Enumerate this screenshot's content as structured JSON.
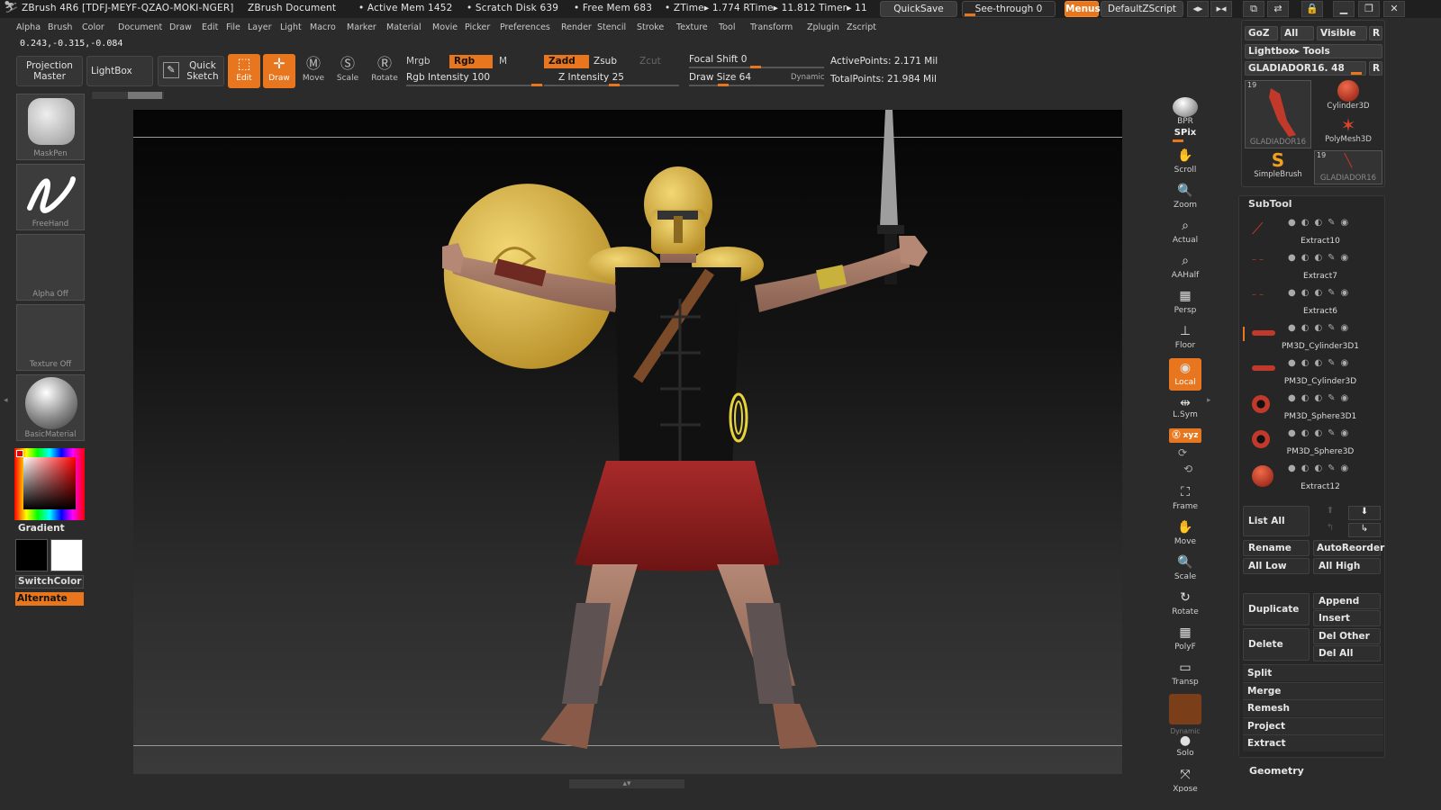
{
  "titlebar": {
    "app": "ZBrush 4R6 [TDFJ-MEYF-QZAO-MOKI-NGER]",
    "document": "ZBrush Document",
    "active_mem": "• Active Mem 1452",
    "scratch_disk": "• Scratch Disk 639",
    "free_mem": "• Free Mem 683",
    "ztime": "• ZTime▸ 1.774 RTime▸ 11.812 Timer▸ 11",
    "quicksave": "QuickSave",
    "see_through": "See-through  0",
    "menus": "Menus",
    "default_zscript": "DefaultZScript"
  },
  "menubar": [
    "Alpha",
    "Brush",
    "Color",
    "Document",
    "Draw",
    "Edit",
    "File",
    "Layer",
    "Light",
    "Macro",
    "Marker",
    "Material",
    "Movie",
    "Picker",
    "Preferences",
    "Render",
    "Stencil",
    "Stroke",
    "Texture",
    "Tool",
    "Transform",
    "Zplugin",
    "Zscript"
  ],
  "coords": "0.243,-0.315,-0.084",
  "shelf": {
    "projection_master": "Projection Master",
    "lightbox": "LightBox",
    "quick_sketch": "Quick Sketch",
    "edit": "Edit",
    "draw": "Draw",
    "move": "Move",
    "scale": "Scale",
    "rotate": "Rotate",
    "mrgb": "Mrgb",
    "rgb": "Rgb",
    "m": "M",
    "zadd": "Zadd",
    "zsub": "Zsub",
    "zcut": "Zcut",
    "rgb_intensity": "Rgb  Intensity 100",
    "z_intensity": "Z Intensity 25",
    "focal_shift": "Focal  Shift 0",
    "draw_size": "Draw  Size 64",
    "dynamic": "Dynamic",
    "active_points": "ActivePoints: 2.171  Mil",
    "total_points": "TotalPoints: 21.984  Mil"
  },
  "left": {
    "brush1": "MaskPen",
    "brush2": "FreeHand",
    "alpha": "Alpha  Off",
    "texture": "Texture  Off",
    "material": "BasicMaterial",
    "gradient": "Gradient",
    "switchcolor": "SwitchColor",
    "alternate": "Alternate"
  },
  "right_shelf": [
    "BPR",
    "SPix",
    "Scroll",
    "Zoom",
    "Actual",
    "AAHalf",
    "Persp",
    "Floor",
    "Local",
    "L.Sym",
    "Frame",
    "Move",
    "Scale",
    "Rotate",
    "PolyF",
    "Transp",
    "Dynamic",
    "Solo",
    "Xpose"
  ],
  "tool": {
    "goz": "GoZ",
    "all": "All",
    "visible": "Visible",
    "r": "R",
    "lightbox_tools": "Lightbox▸ Tools",
    "current": "GLADIADOR16. 48",
    "thumbs": [
      {
        "label": "GLADIADOR16",
        "count": "19"
      },
      {
        "label": "Cylinder3D"
      },
      {
        "label": "PolyMesh3D"
      },
      {
        "label": "SimpleBrush"
      },
      {
        "label": "GLADIADOR16",
        "count": "19"
      }
    ]
  },
  "subtool": {
    "title": "SubTool",
    "items": [
      "Extract10",
      "Extract7",
      "Extract6",
      "PM3D_Cylinder3D1",
      "PM3D_Cylinder3D",
      "PM3D_Sphere3D1",
      "PM3D_Sphere3D",
      "Extract12"
    ],
    "list_all": "List  All",
    "rename": "Rename",
    "autoreorder": "AutoReorder",
    "all_low": "All  Low",
    "all_high": "All  High",
    "duplicate": "Duplicate",
    "append": "Append",
    "insert": "Insert",
    "delete": "Delete",
    "del_other": "Del  Other",
    "del_all": "Del  All",
    "sections": [
      "Split",
      "Merge",
      "Remesh",
      "Project",
      "Extract"
    ],
    "geometry": "Geometry"
  },
  "colors": {
    "accent": "#e8761e",
    "bg": "#2b2b2b",
    "armor": "#d9b54a",
    "skirt": "#8e1e1e"
  }
}
